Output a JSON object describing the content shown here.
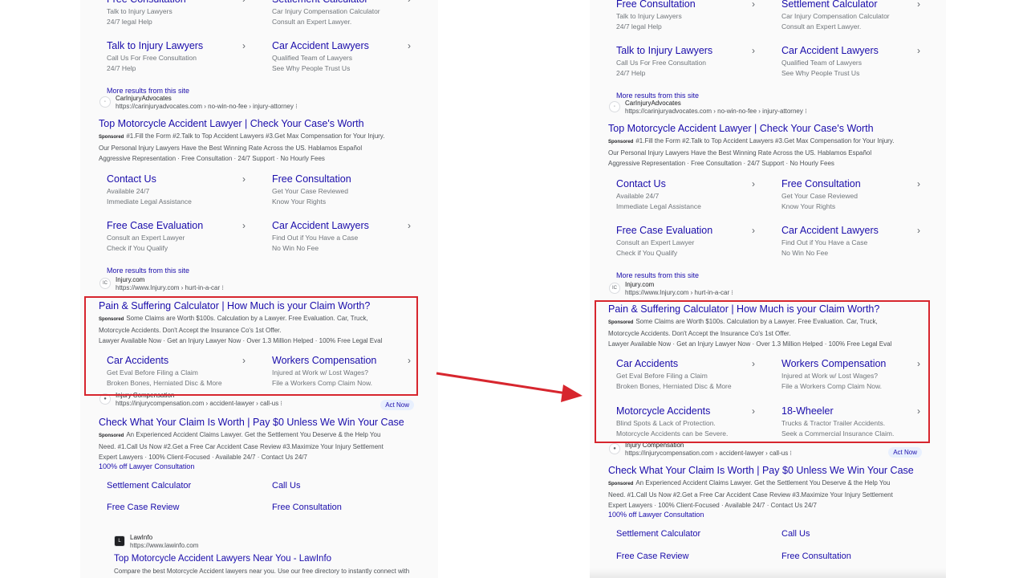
{
  "colors": {
    "link": "#1a0dab",
    "text": "#4d5156",
    "highlight": "#d7262e",
    "arrow": "#d7262e"
  },
  "top_sitelinks": [
    {
      "title": "Free Consultation",
      "lines": [
        "Talk to Injury Lawyers",
        "24/7 legal Help"
      ]
    },
    {
      "title": "Settlement Calculator",
      "lines": [
        "Car Injury Compensation Calculator",
        "Consult an Expert Lawyer."
      ]
    },
    {
      "title": "Talk to Injury Lawyers",
      "lines": [
        "Call Us For Free Consultation",
        "24/7 Help"
      ]
    },
    {
      "title": "Car Accident Lawyers",
      "lines": [
        "Qualified Team of Lawyers",
        "See Why People Trust Us"
      ]
    }
  ],
  "more_results": "More results from this site",
  "ad_car_injury": {
    "source": "CarInjuryAdvocates",
    "url": "https://carinjuryadvocates.com › no-win-no-fee › injury-attorney ⁝",
    "title": "Top Motorcycle Accident Lawyer | Check Your Case's Worth",
    "sponsored": "Sponsored",
    "desc": [
      "#1.Fill the Form #2.Talk to Top Accident Lawyers #3.Get Max Compensation for Your Injury.",
      "Our Personal Injury Lawyers Have the Best Winning Rate Across the US. Hablamos Español",
      "Aggressive Representation · Free Consultation · 24/7 Support · No Hourly Fees"
    ],
    "sitelinks": [
      {
        "title": "Contact Us",
        "lines": [
          "Available 24/7",
          "Immediate Legal Assistance"
        ]
      },
      {
        "title": "Free Consultation",
        "lines": [
          "Get Your Case Reviewed",
          "Know Your Rights"
        ]
      },
      {
        "title": "Free Case Evaluation",
        "lines": [
          "Consult an Expert Lawyer",
          "Check if You Qualify"
        ]
      },
      {
        "title": "Car Accident Lawyers",
        "lines": [
          "Find Out if You Have a Case",
          "No Win No Fee"
        ]
      }
    ]
  },
  "ad_injury": {
    "source": "Injury.com",
    "url": "https://www.Injury.com › hurt-in-a-car ⁝",
    "favicon": "IC",
    "title": "Pain & Suffering Calculator | How Much is your Claim Worth?",
    "sponsored": "Sponsored",
    "desc": [
      "Some Claims are Worth $100s. Calculation by a Lawyer. Free Evaluation. Car, Truck,",
      "Motorcycle Accidents. Don't Accept the Insurance Co's 1st Offer.",
      "Lawyer Available Now · Get an Injury Lawyer Now · Over 1.3 Million Helped · 100% Free Legal Eval"
    ],
    "sitelinks": [
      {
        "title": "Car Accidents",
        "lines": [
          "Get Eval Before Filing a Claim",
          "Broken Bones, Herniated Disc & More"
        ]
      },
      {
        "title": "Workers Compensation",
        "lines": [
          "Injured at Work w/ Lost Wages?",
          "File a Workers Comp Claim Now."
        ]
      },
      {
        "title": "Motorcycle Accidents",
        "lines": [
          "Blind Spots & Lack of Protection.",
          "Motorcycle Accidents can be Severe."
        ]
      },
      {
        "title": "18-Wheeler",
        "lines": [
          "Trucks & Tractor Trailer Accidents.",
          "Seek a Commercial Insurance Claim."
        ]
      }
    ]
  },
  "ad_comp": {
    "source": "Injury Compensation",
    "url": "https://injurycompensation.com › accident-lawyer › call-us ⁝",
    "act_now": "Act Now",
    "title": "Check What Your Claim Is Worth | Pay $0 Unless We Win Your Case",
    "sponsored": "Sponsored",
    "desc": [
      "An Experienced Accident Claims Lawyer. Get the Settlement You Deserve & the Help You",
      "Need. #1.Call Us Now #2.Get a Free Car Accident Case Review #3.Maximize Your Injury Settlement",
      "Expert Lawyers · 100% Client-Focused · Available 24/7 · Contact Us 24/7"
    ],
    "extra": "100% off Lawyer Consultation",
    "links": [
      "Settlement Calculator",
      "Call Us",
      "Free Case Review",
      "Free Consultation"
    ]
  },
  "lawinfo": {
    "source": "LawInfo",
    "url": "https://www.lawinfo.com",
    "favicon": "L",
    "title": "Top Motorcycle Accident Lawyers Near You - LawInfo",
    "desc": [
      "Compare the best Motorcycle Accident lawyers near you. Use our free directory to instantly connect with"
    ]
  }
}
